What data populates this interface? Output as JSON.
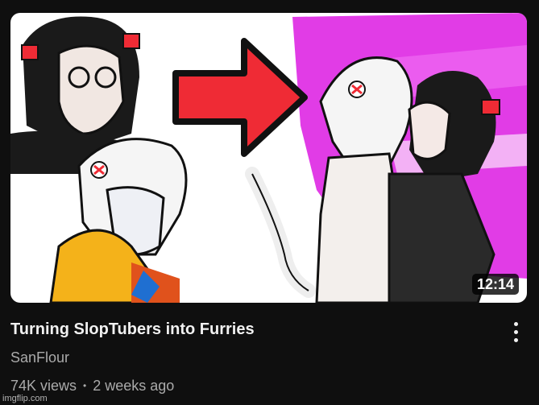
{
  "video": {
    "title": "Turning SlopTubers into Furries",
    "channel": "SanFlour",
    "views": "74K views",
    "separator": "•",
    "age": "2 weeks ago",
    "duration": "12:14"
  },
  "thumbnail": {
    "icon": "thumbnail-illustration",
    "colors": {
      "background": "#ffffff",
      "magenta": "#e13ce6",
      "arrow_red": "#ef2b35",
      "outline": "#111111"
    }
  },
  "more_icon": "more-vert-icon",
  "watermark": "imgflip.com"
}
